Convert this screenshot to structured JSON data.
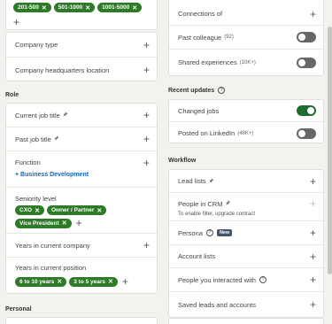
{
  "left": {
    "headcount_pills": [
      "201-500",
      "501-1000",
      "1001-5000"
    ],
    "company_type": "Company type",
    "company_hq": "Company headquarters location",
    "role_section": "Role",
    "current_job_title": "Current job title",
    "past_job_title": "Past job title",
    "function": "Function",
    "function_link": "+ Business Development",
    "seniority": "Seniority level",
    "seniority_pills": [
      "CXO",
      "Owner / Partner",
      "Vice President"
    ],
    "years_company": "Years in current company",
    "years_position": "Years in current position",
    "years_position_pills": [
      "6 to 10 years",
      "3 to 5 years"
    ],
    "personal_section": "Personal"
  },
  "right": {
    "connections_of": "Connections of",
    "past_colleague": "Past colleague",
    "past_colleague_count": "(92)",
    "shared_experiences": "Shared experiences",
    "shared_experiences_count": "(10K+)",
    "recent_updates_section": "Recent updates",
    "changed_jobs": "Changed jobs",
    "posted_linkedin": "Posted on LinkedIn",
    "posted_linkedin_count": "(48K+)",
    "workflow_section": "Workflow",
    "lead_lists": "Lead lists",
    "people_crm": "People in CRM",
    "people_crm_sub": "To enable filter, upgrade contract",
    "persona": "Persona",
    "persona_badge": "New",
    "account_lists": "Account lists",
    "people_interacted": "People you interacted with",
    "saved_leads": "Saved leads and accounts"
  },
  "icons": {
    "plus": "+",
    "close": "✕",
    "pin": "🖈",
    "help": "?"
  },
  "colors": {
    "pill_green": "#2d7a27",
    "link_blue": "#0a66c2",
    "toggle_on": "#1d6b2e",
    "toggle_off": "#666666"
  }
}
